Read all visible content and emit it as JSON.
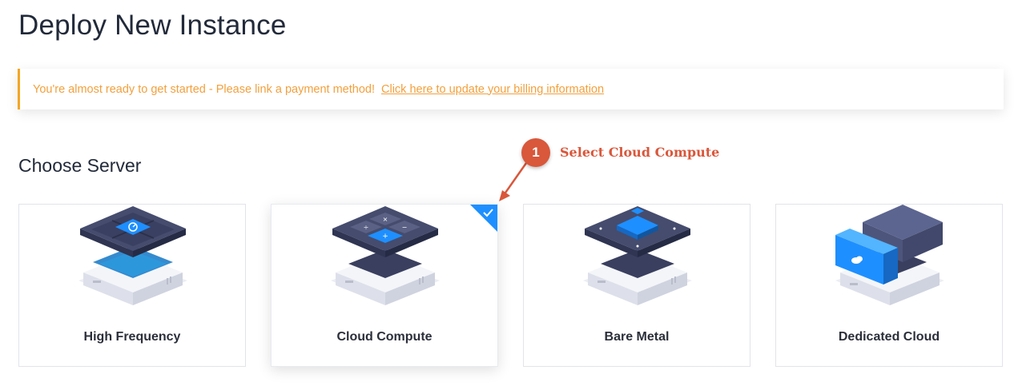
{
  "page": {
    "title": "Deploy New Instance"
  },
  "alert": {
    "message": "You're almost ready to get started - Please link a payment method!",
    "link_text": "Click here to update your billing information"
  },
  "section": {
    "title": "Choose Server"
  },
  "servers": [
    {
      "label": "High Frequency",
      "selected": false
    },
    {
      "label": "Cloud Compute",
      "selected": true
    },
    {
      "label": "Bare Metal",
      "selected": false
    },
    {
      "label": "Dedicated Cloud",
      "selected": false
    }
  ],
  "annotation": {
    "step": "1",
    "text": "Select Cloud Compute"
  },
  "colors": {
    "accent_blue": "#1e8fff",
    "alert_orange": "#f2a03d",
    "annotation_red": "#d9573b",
    "chip_dark": "#3e4566"
  },
  "icons": [
    "speedometer-icon",
    "calculator-icon",
    "cpu-chip-icon",
    "cloud-icon",
    "checkmark-icon"
  ]
}
